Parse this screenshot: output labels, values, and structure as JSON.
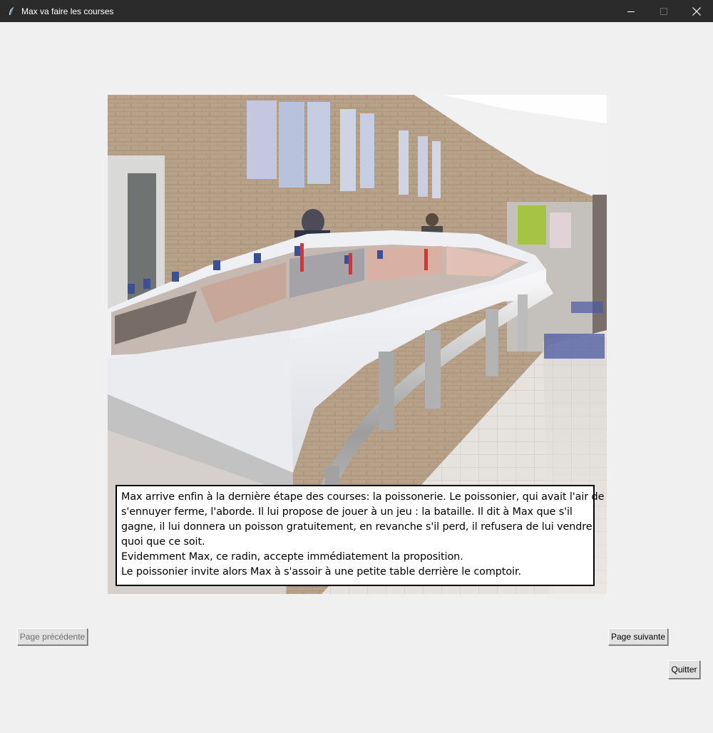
{
  "window": {
    "title": "Max va faire les courses",
    "controls": [
      "minimize-icon",
      "maximize-icon",
      "close-icon"
    ]
  },
  "scene": {
    "image_subject": "fish-counter-photo",
    "story_lines": [
      "Max arrive enfin à la dernière étape des courses: la poissonerie. Le poissonier, qui avait l'air de",
      "s'ennuyer ferme, l'aborde. Il lui propose de jouer à un jeu : la bataille. Il dit à Max que s'il",
      "gagne, il lui donnera un poisson gratuitement, en revanche s'il perd, il refusera de lui vendre",
      "quoi que ce soit.",
      "Evidemment Max, ce radin, accepte immédiatement la proposition.",
      "Le poissonier invite alors Max à s'assoir à une petite table derrière le comptoir."
    ]
  },
  "navigation": {
    "prev_label": "Page précédente",
    "prev_enabled": false,
    "next_label": "Page suivante",
    "quit_label": "Quitter"
  },
  "colors": {
    "titlebar": "#2b2b2b",
    "background": "#f0f0f0",
    "button_face": "#e1e1e1"
  }
}
